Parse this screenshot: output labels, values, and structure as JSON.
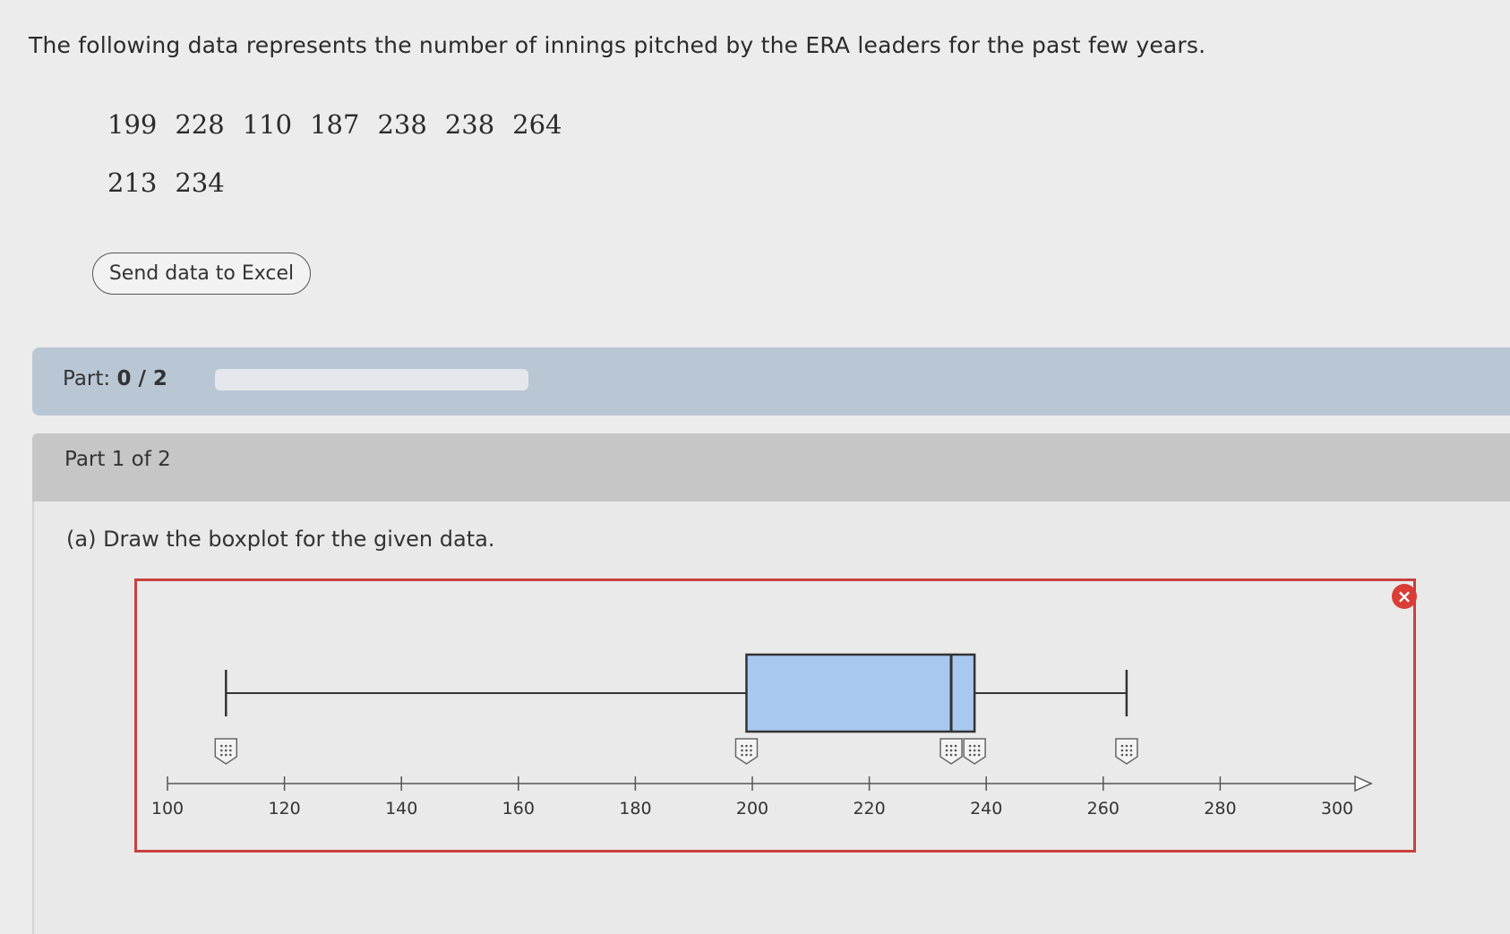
{
  "intro_text": "The following data represents the number of innings pitched by the ERA leaders for the past few years.",
  "data_rows": [
    [
      "199",
      "228",
      "110",
      "187",
      "238",
      "238",
      "264"
    ],
    [
      "213",
      "234"
    ]
  ],
  "excel_button": "Send data to Excel",
  "progress": {
    "label": "Part:",
    "score": "0 / 2",
    "fraction": 0
  },
  "section_title": "Part 1 of 2",
  "question": "(a) Draw the boxplot for the given data.",
  "close_icon": "×",
  "colors": {
    "frame": "#c9413c",
    "box_fill": "#a9c8ef",
    "badge": "#d93d36"
  },
  "chart_data": {
    "type": "boxplot",
    "axis_ticks": [
      100,
      120,
      140,
      160,
      180,
      200,
      220,
      240,
      260,
      280,
      300
    ],
    "xlim": [
      100,
      300
    ],
    "min": 110,
    "q1": 199,
    "median": 234,
    "q3": 238,
    "max": 264,
    "handle_icons": "grip-handle-icon"
  }
}
